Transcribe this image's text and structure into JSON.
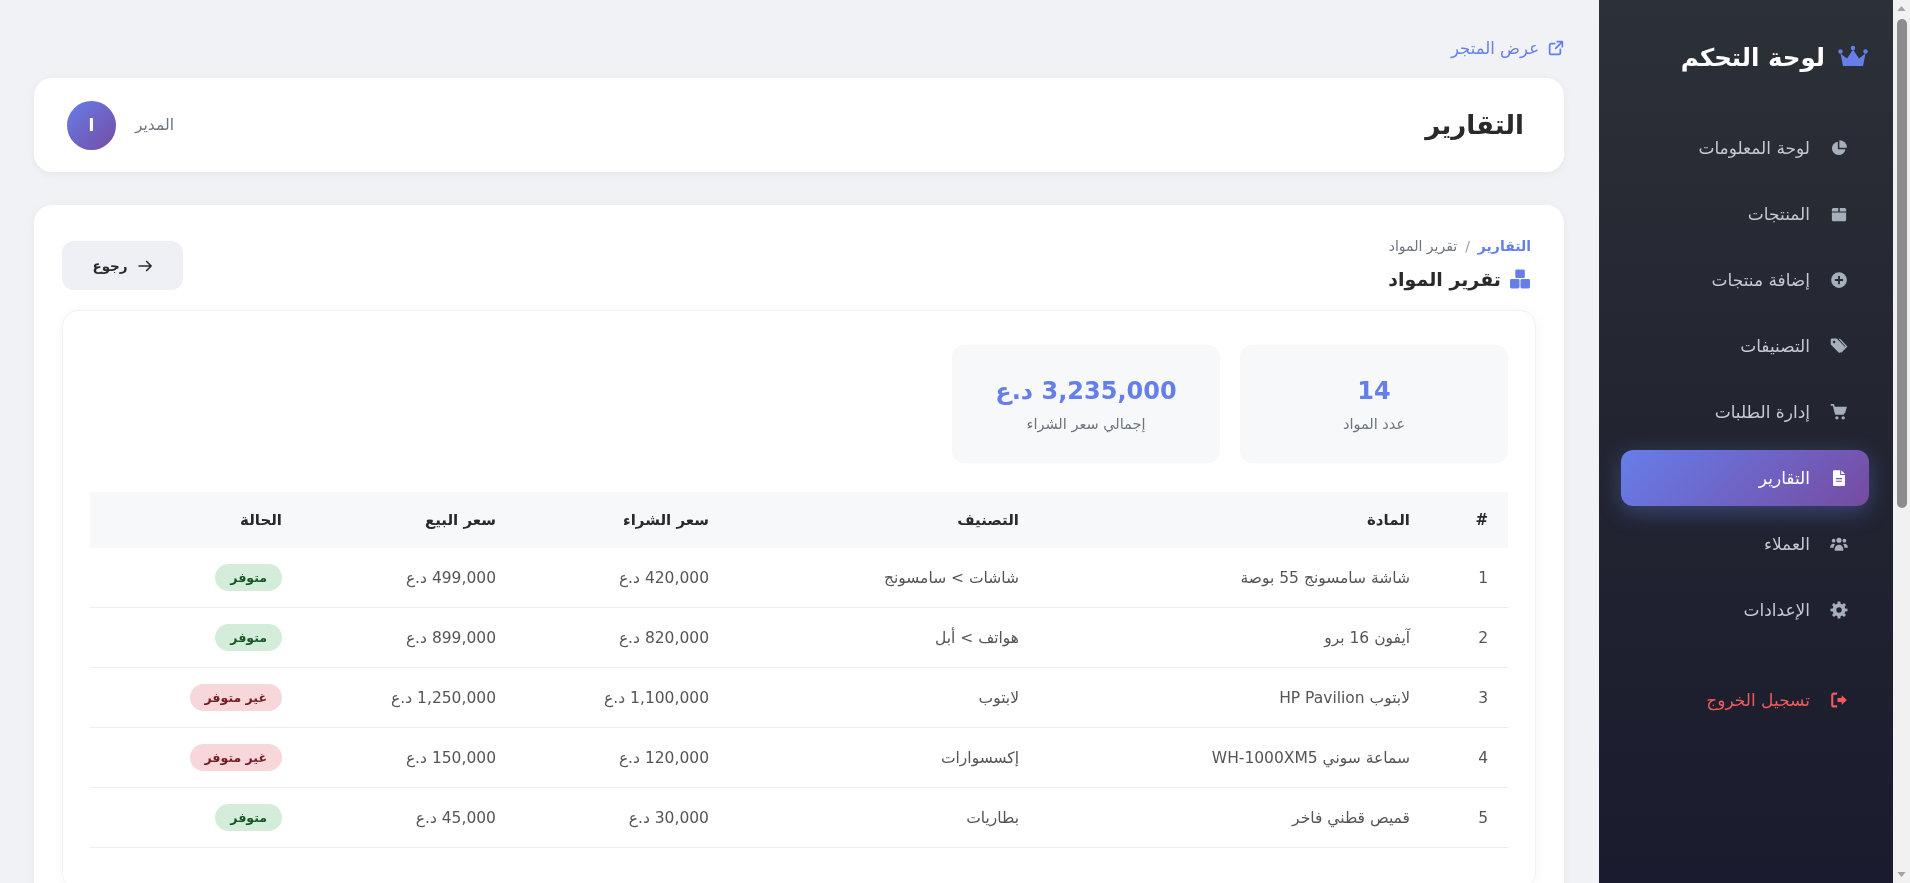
{
  "sidebar": {
    "brand": "لوحة التحكم",
    "items": [
      {
        "label": "لوحة المعلومات",
        "selected": false
      },
      {
        "label": "المنتجات",
        "selected": false
      },
      {
        "label": "إضافة منتجات",
        "selected": false
      },
      {
        "label": "التصنيفات",
        "selected": false
      },
      {
        "label": "إدارة الطلبات",
        "selected": false
      },
      {
        "label": "التقارير",
        "selected": true
      },
      {
        "label": "العملاء",
        "selected": false
      },
      {
        "label": "الإعدادات",
        "selected": false
      }
    ],
    "logout": "تسجيل الخروج"
  },
  "topbar": {
    "store_link": "عرض المتجر"
  },
  "header": {
    "title": "التقارير",
    "user_name": "المدير",
    "avatar_letter": "ا"
  },
  "breadcrumb": {
    "items": [
      {
        "label": "التقارير",
        "kind": "link"
      },
      {
        "label": "تقرير المواد",
        "kind": "current"
      }
    ],
    "separator": "/"
  },
  "page_title": "تقرير المواد",
  "back_button": "رجوع",
  "stats": [
    {
      "value": "14",
      "label": "عدد المواد"
    },
    {
      "value": "3,235,000 د.ع",
      "label": "إجمالي سعر الشراء"
    }
  ],
  "table": {
    "columns": [
      "#",
      "المادة",
      "التصنيف",
      "سعر الشراء",
      "سعر البيع",
      "الحالة"
    ],
    "rows": [
      {
        "cells": [
          "1",
          "شاشة سامسونج 55 بوصة",
          "شاشات > سامسونج",
          "420,000 د.ع",
          "499,000 د.ع"
        ],
        "status": "متوفر",
        "available": true
      },
      {
        "cells": [
          "2",
          "آيفون 16 برو",
          "هواتف > أبل",
          "820,000 د.ع",
          "899,000 د.ع"
        ],
        "status": "متوفر",
        "available": true
      },
      {
        "cells": [
          "3",
          "لابتوب HP Pavilion",
          "لابتوب",
          "1,100,000 د.ع",
          "1,250,000 د.ع"
        ],
        "status": "غير متوفر",
        "available": false
      },
      {
        "cells": [
          "4",
          "سماعة سوني WH-1000XM5",
          "إكسسوارات",
          "120,000 د.ع",
          "150,000 د.ع"
        ],
        "status": "غير متوفر",
        "available": false
      },
      {
        "cells": [
          "5",
          "قميص قطني فاخر",
          "بطاريات",
          "30,000 د.ع",
          "45,000 د.ع"
        ],
        "status": "متوفر",
        "available": true
      }
    ]
  }
}
